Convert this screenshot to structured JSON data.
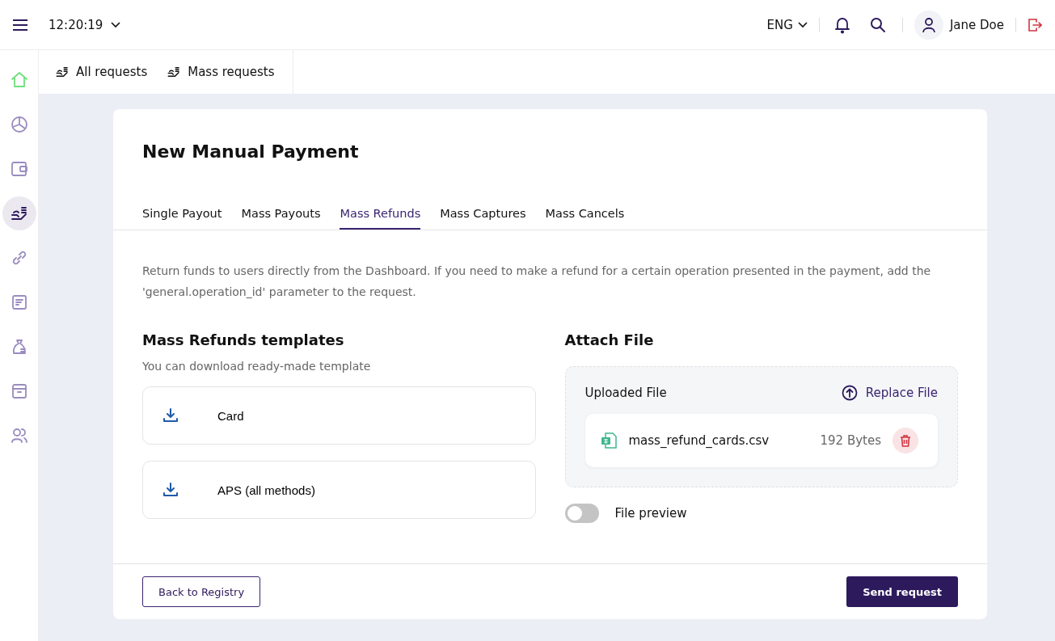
{
  "topbar": {
    "time": "12:20:19",
    "language": "ENG",
    "user": "Jane Doe"
  },
  "sidebar": {
    "items": [
      {
        "kind": "home",
        "selected": false
      },
      {
        "kind": "chart",
        "selected": false
      },
      {
        "kind": "wallet",
        "selected": false
      },
      {
        "kind": "payout",
        "selected": true
      },
      {
        "kind": "link",
        "selected": false
      },
      {
        "kind": "document",
        "selected": false
      },
      {
        "kind": "bag",
        "selected": false
      },
      {
        "kind": "archive",
        "selected": false
      },
      {
        "kind": "users",
        "selected": false
      }
    ]
  },
  "subnav": [
    {
      "label": "All requests"
    },
    {
      "label": "Mass requests"
    }
  ],
  "card": {
    "title": "New Manual Payment",
    "tabs": [
      {
        "label": "Single Payout",
        "selected": false
      },
      {
        "label": "Mass Payouts",
        "selected": false
      },
      {
        "label": "Mass Refunds",
        "selected": true
      },
      {
        "label": "Mass Captures",
        "selected": false
      },
      {
        "label": "Mass Cancels",
        "selected": false
      }
    ],
    "description": "Return funds to users directly from the Dashboard. If you need to make a refund for a certain operation presented in the payment, add the 'general.operation_id' parameter to the request.",
    "templates": {
      "title": "Mass Refunds templates",
      "subtitle": "You can download ready-made template",
      "items": [
        {
          "label": "Card"
        },
        {
          "label": "APS (all methods)"
        }
      ]
    },
    "attach": {
      "title": "Attach File",
      "uploaded_label": "Uploaded File",
      "replace": "Replace File",
      "file": {
        "name": "mass_refund_cards.csv",
        "size": "192 Bytes"
      },
      "preview": {
        "label": "File preview",
        "on": false
      }
    },
    "buttons": {
      "back": "Back to Registry",
      "send": "Send request"
    }
  }
}
